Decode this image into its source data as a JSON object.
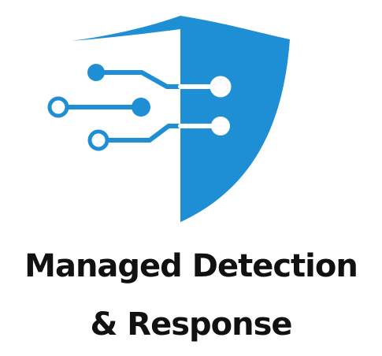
{
  "logo": {
    "icon": "shield-circuit-icon",
    "color": "#1E8FD5"
  },
  "title": {
    "line1": "Managed Detection",
    "line2": "& Response"
  }
}
